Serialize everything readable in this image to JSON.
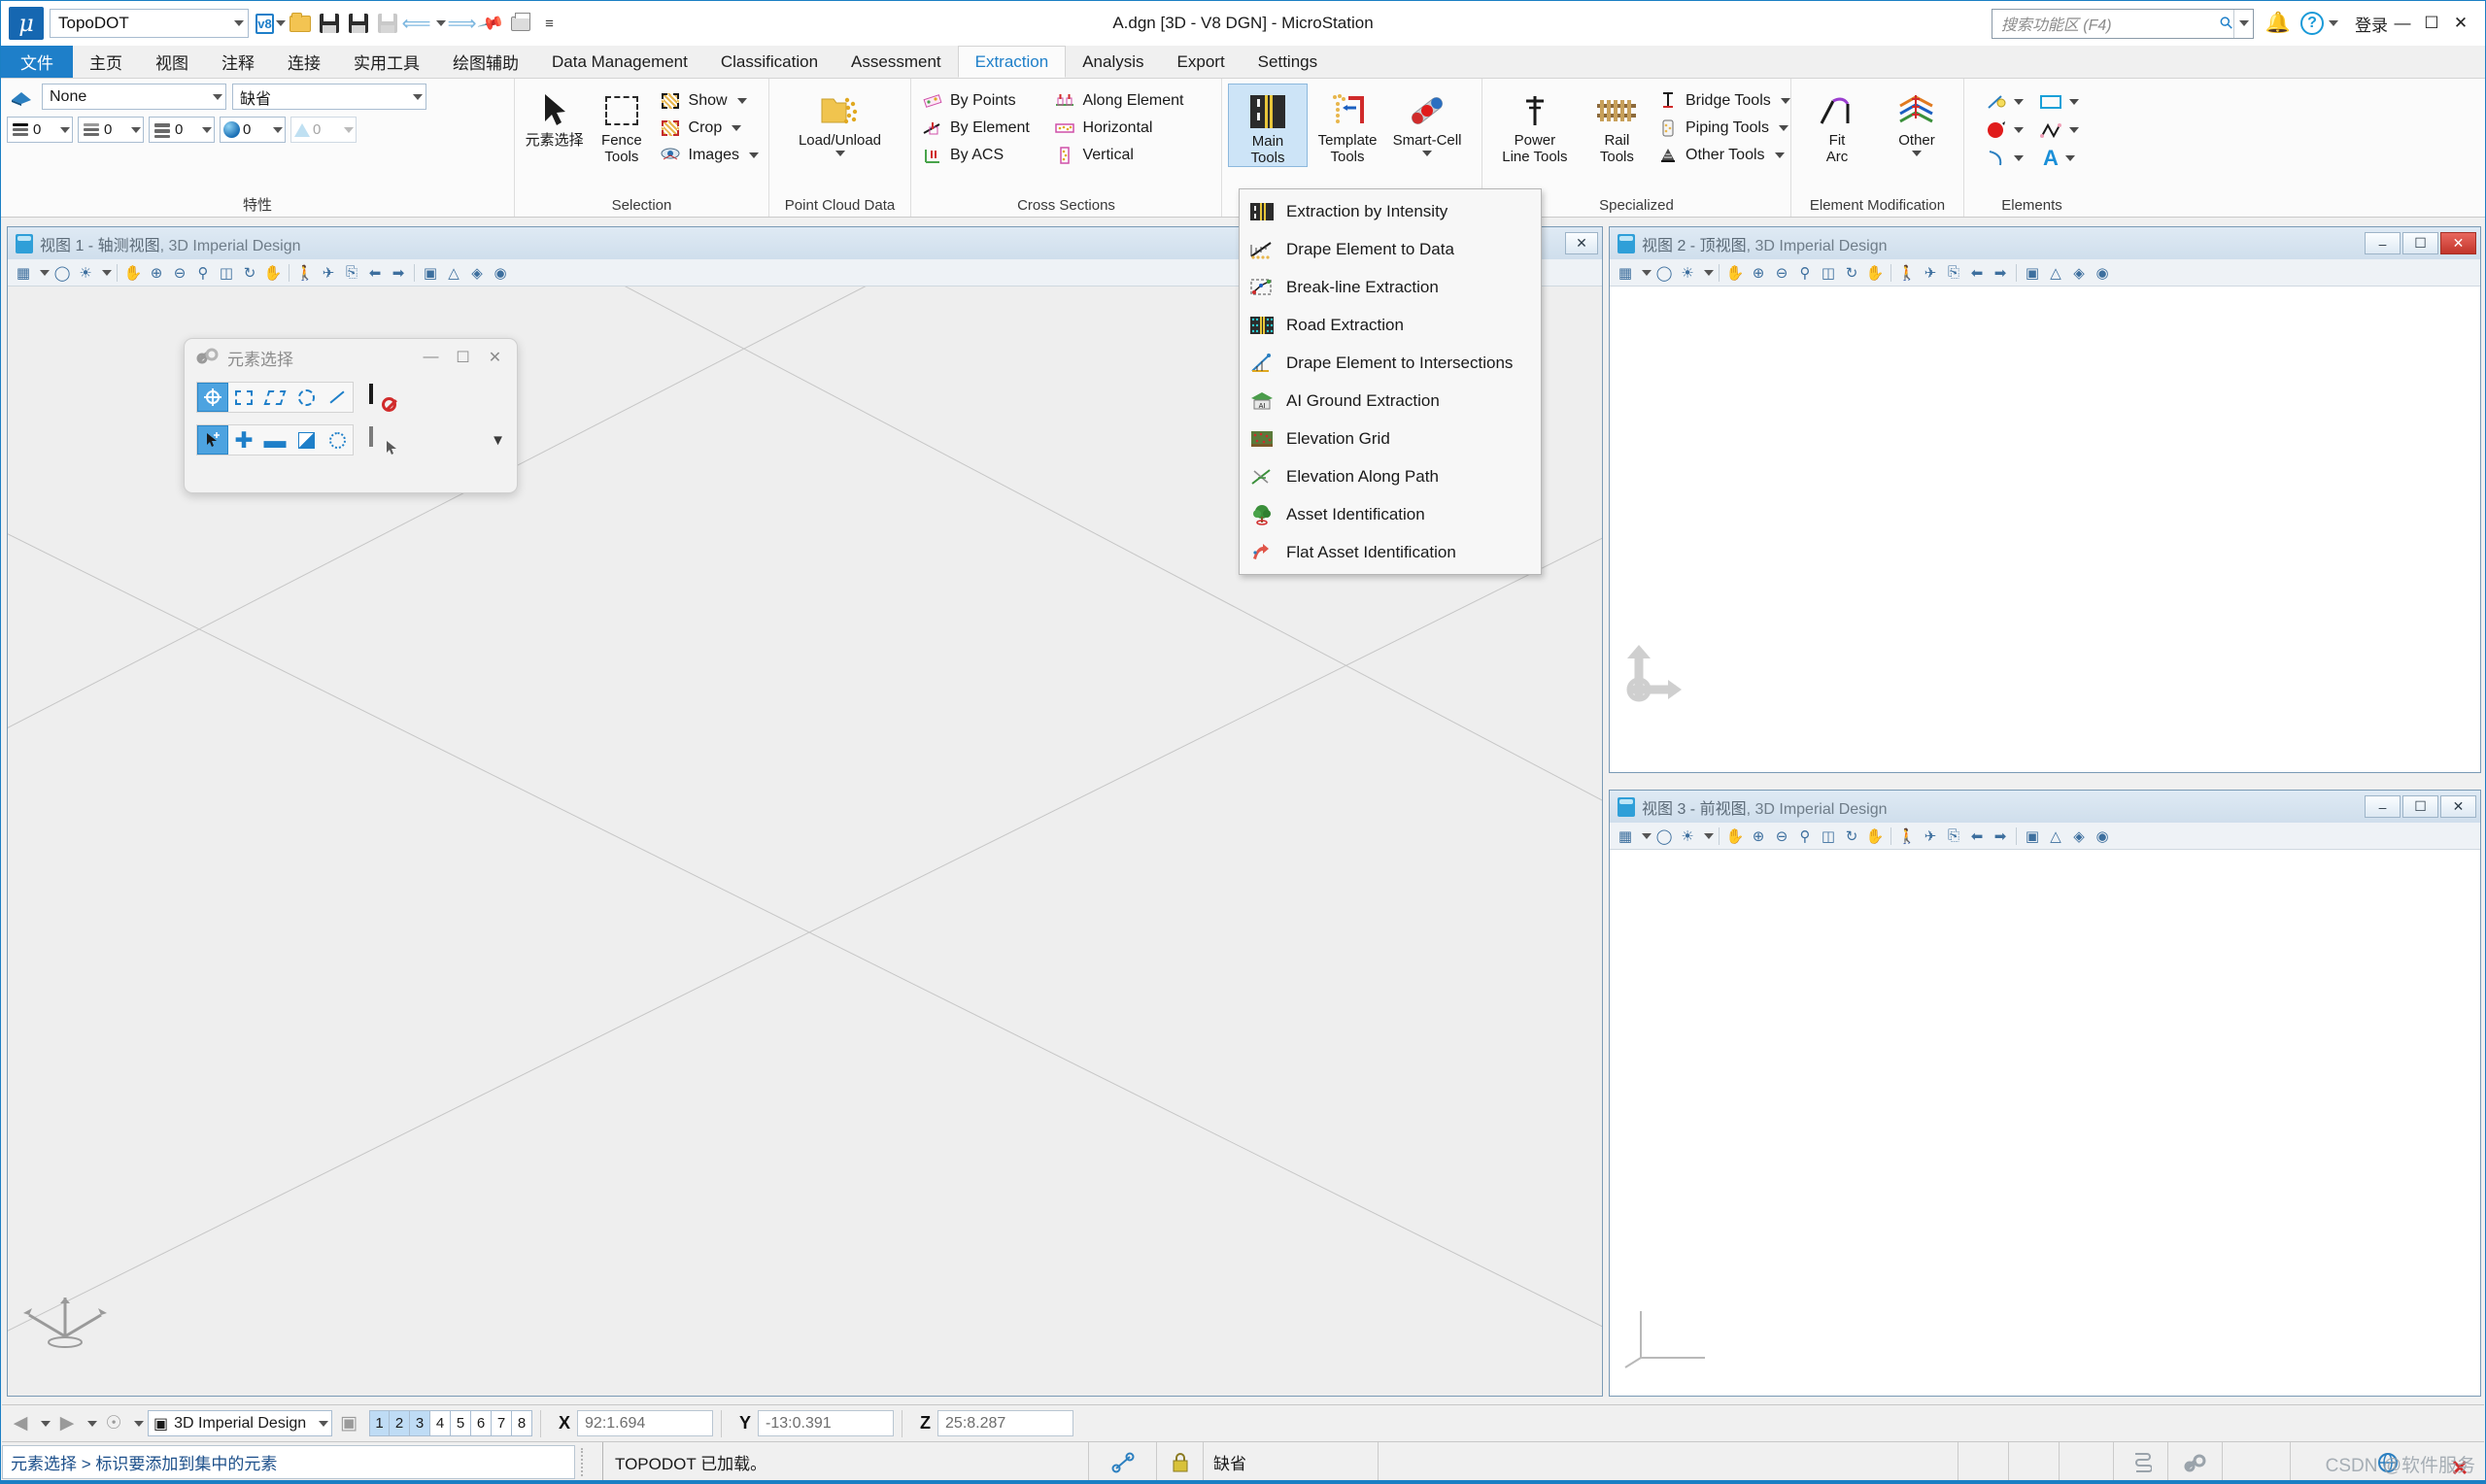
{
  "window": {
    "title": "A.dgn [3D - V8 DGN] - MicroStation",
    "logo_glyph": "μ",
    "quick_access": {
      "workspace_value": "TopoDOT",
      "icons": [
        "v8-format-icon",
        "open-folder-icon",
        "save-icon",
        "save-settings-icon",
        "file-properties-icon",
        "undo-icon",
        "redo-icon",
        "pin-icon",
        "print-icon",
        "more-commands-icon"
      ]
    },
    "search": {
      "placeholder": "搜索功能区 (F4)"
    },
    "login_label": "登录",
    "buttons": {
      "minimize": "—",
      "maximize": "☐",
      "close": "✕"
    }
  },
  "tabs": [
    {
      "label": "文件",
      "state": "file"
    },
    {
      "label": "主页",
      "state": "normal"
    },
    {
      "label": "视图",
      "state": "normal"
    },
    {
      "label": "注释",
      "state": "normal"
    },
    {
      "label": "连接",
      "state": "normal"
    },
    {
      "label": "实用工具",
      "state": "normal"
    },
    {
      "label": "绘图辅助",
      "state": "normal"
    },
    {
      "label": "Data Management",
      "state": "normal"
    },
    {
      "label": "Classification",
      "state": "normal"
    },
    {
      "label": "Assessment",
      "state": "normal"
    },
    {
      "label": "Extraction",
      "state": "active"
    },
    {
      "label": "Analysis",
      "state": "normal"
    },
    {
      "label": "Export",
      "state": "normal"
    },
    {
      "label": "Settings",
      "state": "normal"
    }
  ],
  "ribbon": {
    "properties": {
      "group_label": "特性",
      "level_value": "None",
      "style_value": "缺省",
      "spinners": [
        {
          "name": "color",
          "value": "0"
        },
        {
          "name": "line-style",
          "value": "0"
        },
        {
          "name": "line-weight",
          "value": "0"
        },
        {
          "name": "transparency",
          "value": "0"
        },
        {
          "name": "priority",
          "value": "0"
        }
      ]
    },
    "selection": {
      "group_label": "Selection",
      "element_select_label": "元素选择",
      "fence_tools_label": "Fence\nTools",
      "items": [
        {
          "label": "Show",
          "icon": "show-icon"
        },
        {
          "label": "Crop",
          "icon": "crop-icon"
        },
        {
          "label": "Images",
          "icon": "images-icon"
        }
      ]
    },
    "point_cloud": {
      "group_label": "Point Cloud Data",
      "load_unload_label": "Load/Unload"
    },
    "cross_sections": {
      "group_label": "Cross Sections",
      "col1": [
        {
          "label": "By Points",
          "icon": "by-points-icon"
        },
        {
          "label": "By Element",
          "icon": "by-element-icon"
        },
        {
          "label": "By ACS",
          "icon": "by-acs-icon"
        }
      ],
      "col2": [
        {
          "label": "Along Element",
          "icon": "along-element-icon"
        },
        {
          "label": "Horizontal",
          "icon": "horizontal-icon"
        },
        {
          "label": "Vertical",
          "icon": "vertical-icon"
        }
      ]
    },
    "extraction": {
      "main_tools_label": "Main\nTools",
      "template_tools_label": "Template\nTools",
      "smart_cell_label": "Smart-Cell"
    },
    "specialized": {
      "group_label": "Specialized",
      "power_line_label": "Power\nLine Tools",
      "rail_tools_label": "Rail\nTools",
      "items": [
        {
          "label": "Bridge Tools",
          "icon": "bridge-tools-icon"
        },
        {
          "label": "Piping Tools",
          "icon": "piping-tools-icon"
        },
        {
          "label": "Other Tools",
          "icon": "other-tools-icon"
        }
      ]
    },
    "element_modification": {
      "group_label": "Element Modification",
      "fit_arc_label": "Fit\nArc",
      "other_label": "Other"
    },
    "elements": {
      "group_label": "Elements",
      "items": [
        {
          "name": "line-icon"
        },
        {
          "name": "rectangle-icon"
        },
        {
          "name": "circle-icon"
        },
        {
          "name": "polyline-icon"
        },
        {
          "name": "arc-icon"
        },
        {
          "name": "text-icon"
        }
      ]
    }
  },
  "main_tools_menu": [
    {
      "label": "Extraction by Intensity",
      "icon": "intensity-icon"
    },
    {
      "label": "Drape Element to Data",
      "icon": "drape-data-icon"
    },
    {
      "label": "Break-line Extraction",
      "icon": "breakline-icon"
    },
    {
      "label": "Road Extraction",
      "icon": "road-icon"
    },
    {
      "label": "Drape Element to Intersections",
      "icon": "drape-intersections-icon"
    },
    {
      "label": "AI Ground Extraction",
      "icon": "ai-ground-icon"
    },
    {
      "label": "Elevation Grid",
      "icon": "elevation-grid-icon"
    },
    {
      "label": "Elevation Along Path",
      "icon": "elevation-path-icon"
    },
    {
      "label": "Asset Identification",
      "icon": "asset-id-icon"
    },
    {
      "label": "Flat Asset Identification",
      "icon": "flat-asset-id-icon"
    }
  ],
  "views": [
    {
      "id": "view1",
      "title_num": "视图 1 - 轴测视图",
      "title_file": "3D Imperial Design"
    },
    {
      "id": "view2",
      "title_num": "视图 2 - 顶视图",
      "title_file": "3D Imperial Design"
    },
    {
      "id": "view3",
      "title_num": "视图 3 - 前视图",
      "title_file": "3D Imperial Design"
    }
  ],
  "dialog": {
    "title": "元素选择",
    "buttons": {
      "minimize": "—",
      "maximize": "☐",
      "close": "✕"
    },
    "method_tools": [
      "individual-icon",
      "block-icon",
      "shape-icon",
      "circle-icon",
      "line-icon"
    ],
    "mode_tools": [
      "new-icon",
      "add-icon",
      "subtract-icon",
      "invert-icon",
      "clear-icon"
    ],
    "right_tools": [
      "no-selection-icon",
      "pointer-selection-icon"
    ],
    "expand_glyph": "▼"
  },
  "statusbar": {
    "model_value": "3D Imperial Design",
    "levels": [
      {
        "label": "1",
        "on": true
      },
      {
        "label": "2",
        "on": true
      },
      {
        "label": "3",
        "on": true
      },
      {
        "label": "4",
        "on": false
      },
      {
        "label": "5",
        "on": false
      },
      {
        "label": "6",
        "on": false
      },
      {
        "label": "7",
        "on": false
      },
      {
        "label": "8",
        "on": false
      }
    ],
    "coords": [
      {
        "axis": "X",
        "value": "92:1.694"
      },
      {
        "axis": "Y",
        "value": "-13:0.391"
      },
      {
        "axis": "Z",
        "value": "25:8.287"
      }
    ]
  },
  "bottombar": {
    "prompt": "元素选择 > 标识要添加到集中的元素",
    "message": "TOPODOT 已加载。",
    "level_value": "缺省",
    "watermark": "CSDN @软件服务"
  },
  "colors": {
    "accent": "#1e7fc9",
    "file_tab": "#1e7fc9",
    "selected_btn": "#cde4f7",
    "canvas": "#eeeeee"
  }
}
